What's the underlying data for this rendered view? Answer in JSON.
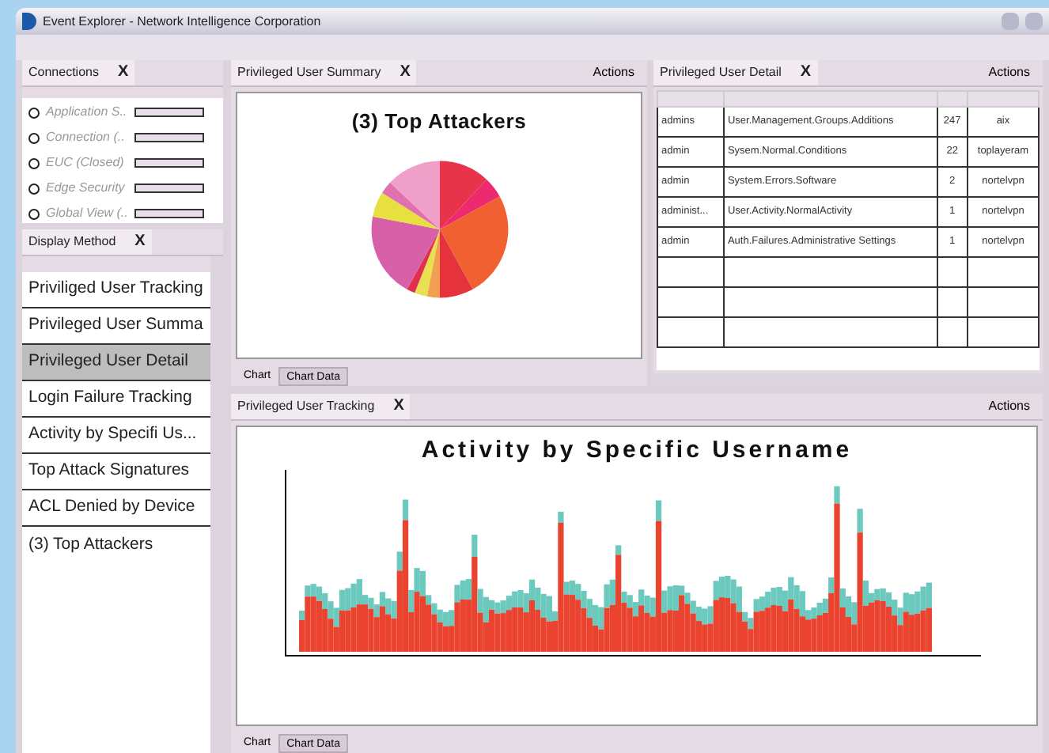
{
  "window": {
    "title": "Event Explorer - Network Intelligence Corporation"
  },
  "connections": {
    "title": "Connections",
    "close": "X",
    "items": [
      {
        "name": "Application S.."
      },
      {
        "name": "Connection (.."
      },
      {
        "name": "EUC (Closed)"
      },
      {
        "name": "Edge Security"
      },
      {
        "name": "Global View (.."
      }
    ]
  },
  "display_method": {
    "title": "Display Method",
    "close": "X",
    "items": [
      {
        "label": "Priviliged User Tracking",
        "selected": false
      },
      {
        "label": "Privileged User Summa",
        "selected": false
      },
      {
        "label": "Privileged User Detail",
        "selected": true
      },
      {
        "label": "Login Failure Tracking",
        "selected": false
      },
      {
        "label": "Activity by Specifi Us...",
        "selected": false
      },
      {
        "label": "Top Attack Signatures",
        "selected": false
      },
      {
        "label": "ACL Denied by Device",
        "selected": false
      },
      {
        "label": "(3) Top Attackers",
        "selected": false
      }
    ]
  },
  "summary_panel": {
    "title": "Privileged User Summary",
    "close": "X",
    "actions": "Actions",
    "chart_title": "(3) Top Attackers",
    "tabs": [
      {
        "label": "Chart",
        "selected": true
      },
      {
        "label": "Chart Data",
        "selected": false
      }
    ]
  },
  "detail_panel": {
    "title": "Privileged User Detail",
    "close": "X",
    "actions": "Actions",
    "rows": [
      [
        "admins",
        "User.Management.Groups.Additions",
        "247",
        "aix"
      ],
      [
        "admin",
        "Sysem.Normal.Conditions",
        "22",
        "toplayeram"
      ],
      [
        "admin",
        "System.Errors.Software",
        "2",
        "nortelvpn"
      ],
      [
        "administ...",
        "User.Activity.NormalActivity",
        "1",
        "nortelvpn"
      ],
      [
        "admin",
        "Auth.Failures.Administrative Settings",
        "1",
        "nortelvpn"
      ]
    ]
  },
  "tracking_panel": {
    "title": "Privileged User Tracking",
    "close": "X",
    "actions": "Actions",
    "chart_title": "Activity by Specific Username",
    "tabs": [
      {
        "label": "Chart",
        "selected": true
      },
      {
        "label": "Chart Data",
        "selected": false
      }
    ]
  }
}
